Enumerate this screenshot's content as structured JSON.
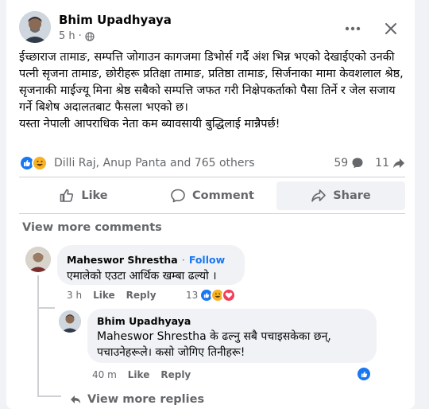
{
  "post": {
    "author": "Bhim Upadhyaya",
    "time": "5 h",
    "text": "ईच्छाराज तामाङ, सम्पत्ति जोगाउन कागजमा डिभोर्स गर्दै अंश भिन्न भएको देखाईएको उनकी पत्नी सृजना तामाङ, छोरीहरू प्रतिक्षा तामाङ, प्रतिष्ठा तामाङ, सिर्जनाका मामा केवशलाल श्रेष्ठ, सृजनाकी माईज्यू मिना श्रेष्ठ सबैको सम्पत्ति जफत गरी निक्षेपकर्ताको पैसा तिर्ने र जेल सजाय गर्ने बिशेष अदालतबाट फैसला भएको छ।\nयस्ता नेपाली आपराधिक नेता कम ब्यावसायी बुद्धिलाई मान्नैपर्छ!",
    "reactors": "Dilli Raj, Anup Panta and 765 others",
    "comment_count": "59",
    "share_count": "11"
  },
  "actions": {
    "like": "Like",
    "comment": "Comment",
    "share": "Share"
  },
  "view_more_comments": "View more comments",
  "comment": {
    "author": "Maheswor Shrestha",
    "separator": "·",
    "follow": "Follow",
    "text": "एमालेको एउटा आर्थिक खम्बा ढल्यो ।",
    "time": "3 h",
    "like": "Like",
    "reply": "Reply",
    "reaction_count": "13"
  },
  "reply": {
    "author": "Bhim Upadhyaya",
    "text": "Maheswor Shrestha के ढल्नु सबै पचाइसकेका छन्, पचाउनेहरूले। कसो जोगिए तिनीहरू!",
    "time": "40 m",
    "like": "Like",
    "reply": "Reply"
  },
  "view_more_replies": "View more replies",
  "colors": {
    "accent": "#1877f2",
    "secondary_text": "#65676b",
    "bubble": "#f0f2f5",
    "haha": "#f7b125",
    "love": "#f33e58"
  }
}
